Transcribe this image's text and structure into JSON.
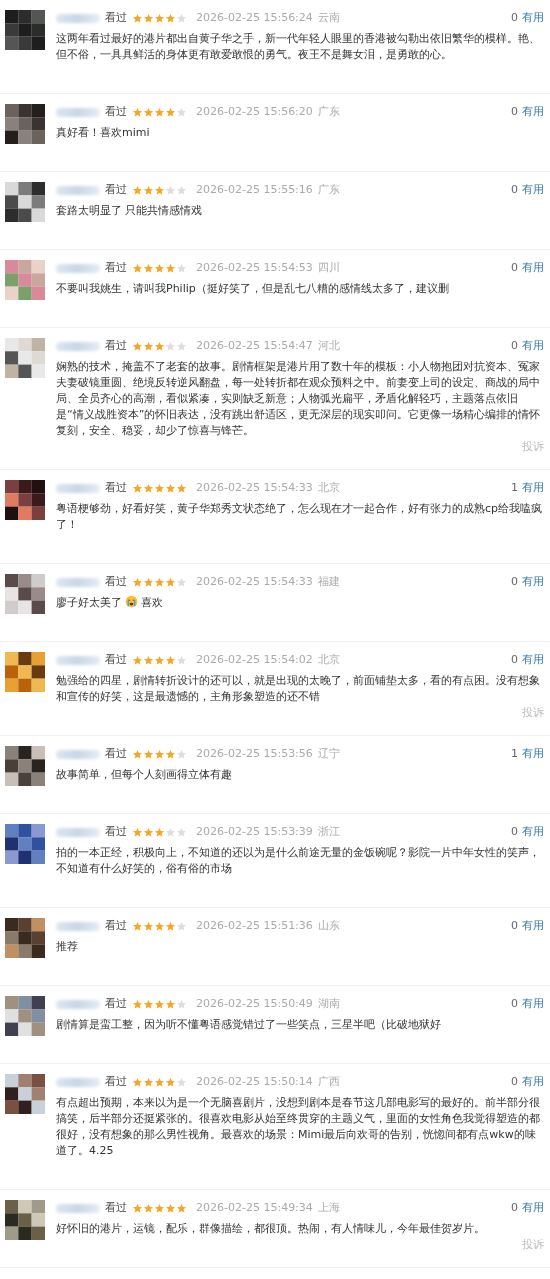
{
  "comments": [
    {
      "status": "看过",
      "stars": 4,
      "time": "2026-02-25 15:56:24",
      "location": "云南",
      "useful_count": "0",
      "useful_label": "有用",
      "text": "这两年看过最好的港片都出自黄子华之手，新一代年轻人眼里的香港被勾勒出依旧繁华的模样。艳、但不俗，一具具鲜活的身体更有敢爱敢恨的勇气。夜王不是舞女泪，是勇敢的心。"
    },
    {
      "status": "看过",
      "stars": 4,
      "time": "2026-02-25 15:56:20",
      "location": "广东",
      "useful_count": "0",
      "useful_label": "有用",
      "text": "真好看！喜欢mimi"
    },
    {
      "status": "看过",
      "stars": 3,
      "time": "2026-02-25 15:55:16",
      "location": "广东",
      "useful_count": "0",
      "useful_label": "有用",
      "text": "套路太明显了 只能共情感情戏"
    },
    {
      "status": "看过",
      "stars": 4,
      "time": "2026-02-25 15:54:53",
      "location": "四川",
      "useful_count": "0",
      "useful_label": "有用",
      "text": "不要叫我姚生，请叫我Philip（挺好笑了，但是乱七八糟的感情线太多了，建议删"
    },
    {
      "status": "看过",
      "stars": 3,
      "time": "2026-02-25 15:54:47",
      "location": "河北",
      "useful_count": "0",
      "useful_label": "有用",
      "text": "娴熟的技术，掩盖不了老套的故事。剧情框架是港片用了数十年的模板：小人物抱团对抗资本、冤家夫妻破镜重圆、绝境反转逆风翻盘，每一处转折都在观众预料之中。前妻变上司的设定、商战的局中局、全员齐心的高潮，看似紧凑，实则缺乏新意；人物弧光扁平，矛盾化解轻巧，主题落点依旧是“情义战胜资本”的怀旧表达，没有跳出舒适区，更无深层的现实叩问。它更像一场精心编排的情怀复刻，安全、稳妥，却少了惊喜与锋芒。",
      "report": "投诉"
    },
    {
      "status": "看过",
      "stars": 5,
      "time": "2026-02-25 15:54:33",
      "location": "北京",
      "useful_count": "1",
      "useful_label": "有用",
      "text": "粤语梗够劲，好看好笑，黄子华郑秀文状态绝了，怎么现在才一起合作，好有张力的成熟cp给我嗑疯了！"
    },
    {
      "status": "看过",
      "stars": 4,
      "time": "2026-02-25 15:54:33",
      "location": "福建",
      "useful_count": "0",
      "useful_label": "有用",
      "text": "廖子好太美了",
      "emoji": true,
      "text_after": "喜欢"
    },
    {
      "status": "看过",
      "stars": 4,
      "time": "2026-02-25 15:54:02",
      "location": "北京",
      "useful_count": "0",
      "useful_label": "有用",
      "text": "勉强给的四星，剧情转折设计的还可以，就是出现的太晚了，前面铺垫太多，看的有点困。没有想象和宣传的好笑，这是最遗憾的，主角形象塑造的还不错",
      "report": "投诉"
    },
    {
      "status": "看过",
      "stars": 4,
      "time": "2026-02-25 15:53:56",
      "location": "辽宁",
      "useful_count": "1",
      "useful_label": "有用",
      "text": "故事简单，但每个人刻画得立体有趣"
    },
    {
      "status": "看过",
      "stars": 3,
      "time": "2026-02-25 15:53:39",
      "location": "浙江",
      "useful_count": "0",
      "useful_label": "有用",
      "text": "拍的一本正经，积极向上，不知道的还以为是什么前途无量的金饭碗呢？影院一片中年女性的笑声，不知道有什么好笑的，俗有俗的市场"
    },
    {
      "status": "看过",
      "stars": 4,
      "time": "2026-02-25 15:51:36",
      "location": "山东",
      "useful_count": "0",
      "useful_label": "有用",
      "text": "推荐"
    },
    {
      "status": "看过",
      "stars": 4,
      "time": "2026-02-25 15:50:49",
      "location": "湖南",
      "useful_count": "0",
      "useful_label": "有用",
      "text": "剧情算是蛮工整，因为听不懂粤语感觉错过了一些笑点，三星半吧（比破地狱好"
    },
    {
      "status": "看过",
      "stars": 4,
      "time": "2026-02-25 15:50:14",
      "location": "广西",
      "useful_count": "0",
      "useful_label": "有用",
      "text": "有点超出预期，本来以为是一个无脑喜剧片，没想到剧本是春节这几部电影写的最好的。前半部分很搞笑，后半部分还挺紧张的。很喜欢电影从始至终贯穿的主题义气，里面的女性角色我觉得塑造的都很好，没有想象的那么男性视角。最喜欢的场景：Mimi最后向欢哥的告别，恍惚间都有点wkw的味道了。4.25"
    },
    {
      "status": "看过",
      "stars": 5,
      "time": "2026-02-25 15:49:34",
      "location": "上海",
      "useful_count": "0",
      "useful_label": "有用",
      "text": "好怀旧的港片，运镜，配乐，群像描绘，都很顶。热闹，有人情味儿，今年最佳贺岁片。",
      "report": "投诉"
    }
  ]
}
